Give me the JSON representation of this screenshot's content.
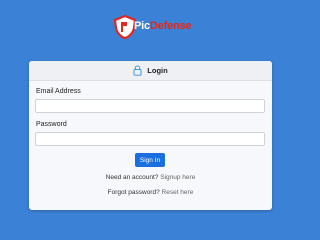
{
  "brand": {
    "name_part1": "Pic",
    "name_part2": "Defense",
    "colors": {
      "accent_red": "#e0281d",
      "background_blue": "#3b82d6",
      "button_blue": "#1a6fe0"
    }
  },
  "login_card": {
    "title": "Login",
    "icon": "lock-icon",
    "email_label": "Email Address",
    "email_value": "",
    "email_placeholder": "",
    "password_label": "Password",
    "password_value": "",
    "password_placeholder": "",
    "signin_label": "Sign In",
    "signup_prompt": "Need an account?",
    "signup_link": "Signup here",
    "forgot_prompt": "Forgot password?",
    "reset_link": "Reset here"
  }
}
